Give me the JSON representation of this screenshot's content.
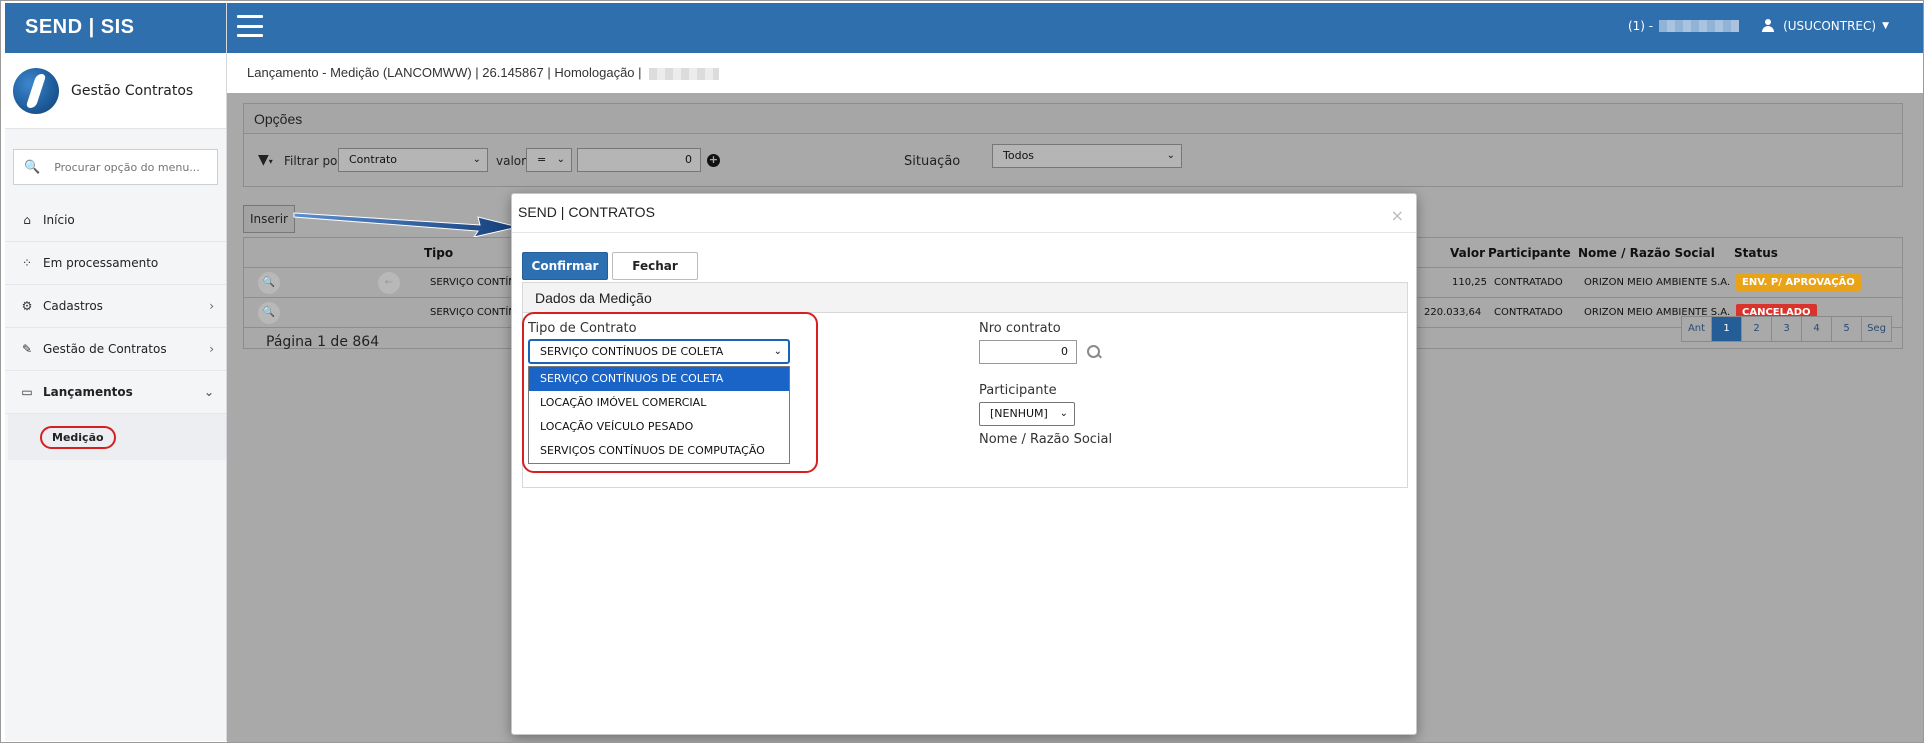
{
  "brand": {
    "title": "SEND | SIS"
  },
  "sidebar": {
    "module_title": "Gestão Contratos",
    "search_placeholder": "Procurar opção do menu...",
    "items": [
      {
        "label": "Início",
        "icon": "home-icon"
      },
      {
        "label": "Em processamento",
        "icon": "spinner-icon"
      },
      {
        "label": "Cadastros",
        "icon": "gears-icon"
      },
      {
        "label": "Gestão de Contratos",
        "icon": "edit-icon"
      },
      {
        "label": "Lançamentos",
        "icon": "laptop-icon"
      }
    ],
    "sub_item": "Medição"
  },
  "topbar": {
    "session": "(1) -",
    "user": "(USUCONTREC)"
  },
  "breadcrumb": {
    "text": "Lançamento - Medição (LANCOMWW) | 26.145867 | Homologação |"
  },
  "opcoes": {
    "title": "Opções",
    "filter_label": "Filtrar por",
    "filter_field": "Contrato",
    "valor_label": "valor",
    "operator": "=",
    "value": "0",
    "situacao_label": "Situação",
    "situacao_value": "Todos"
  },
  "toolbar": {
    "inserir": "Inserir"
  },
  "grid": {
    "headers": {
      "tipo": "Tipo",
      "valor": "Valor",
      "participante": "Participante",
      "nome": "Nome / Razão Social",
      "status": "Status"
    },
    "rows": [
      {
        "tipo": "SERVIÇO CONTÍN",
        "valor": "110,25",
        "participante": "CONTRATADO",
        "nome": "ORIZON MEIO AMBIENTE S.A.",
        "status": "ENV. P/ APROVAÇÃO",
        "status_color": "#e8a319"
      },
      {
        "tipo": "SERVIÇO CONTÍN",
        "valor": "220.033,64",
        "participante": "CONTRATADO",
        "nome": "ORIZON MEIO AMBIENTE S.A.",
        "status": "CANCELADO",
        "status_color": "#d9342b"
      }
    ],
    "pager_text": "Página 1 de 864",
    "pages": [
      "Ant",
      "1",
      "2",
      "3",
      "4",
      "5",
      "Seg"
    ]
  },
  "modal": {
    "title": "SEND | CONTRATOS",
    "confirmar": "Confirmar",
    "fechar": "Fechar",
    "section_title": "Dados da Medição",
    "tipo_contrato_label": "Tipo de Contrato",
    "tipo_contrato_value": "SERVIÇO CONTÍNUOS DE COLETA",
    "tipo_contrato_options": [
      "SERVIÇO CONTÍNUOS DE COLETA",
      "LOCAÇÃO IMÓVEL COMERCIAL",
      "LOCAÇÃO VEÍCULO PESADO",
      "SERVIÇOS CONTÍNUOS DE COMPUTAÇÃO"
    ],
    "nro_contrato_label": "Nro contrato",
    "nro_contrato_value": "0",
    "participante_label": "Participante",
    "participante_value": "[NENHUM]",
    "nome_label": "Nome / Razão Social"
  }
}
